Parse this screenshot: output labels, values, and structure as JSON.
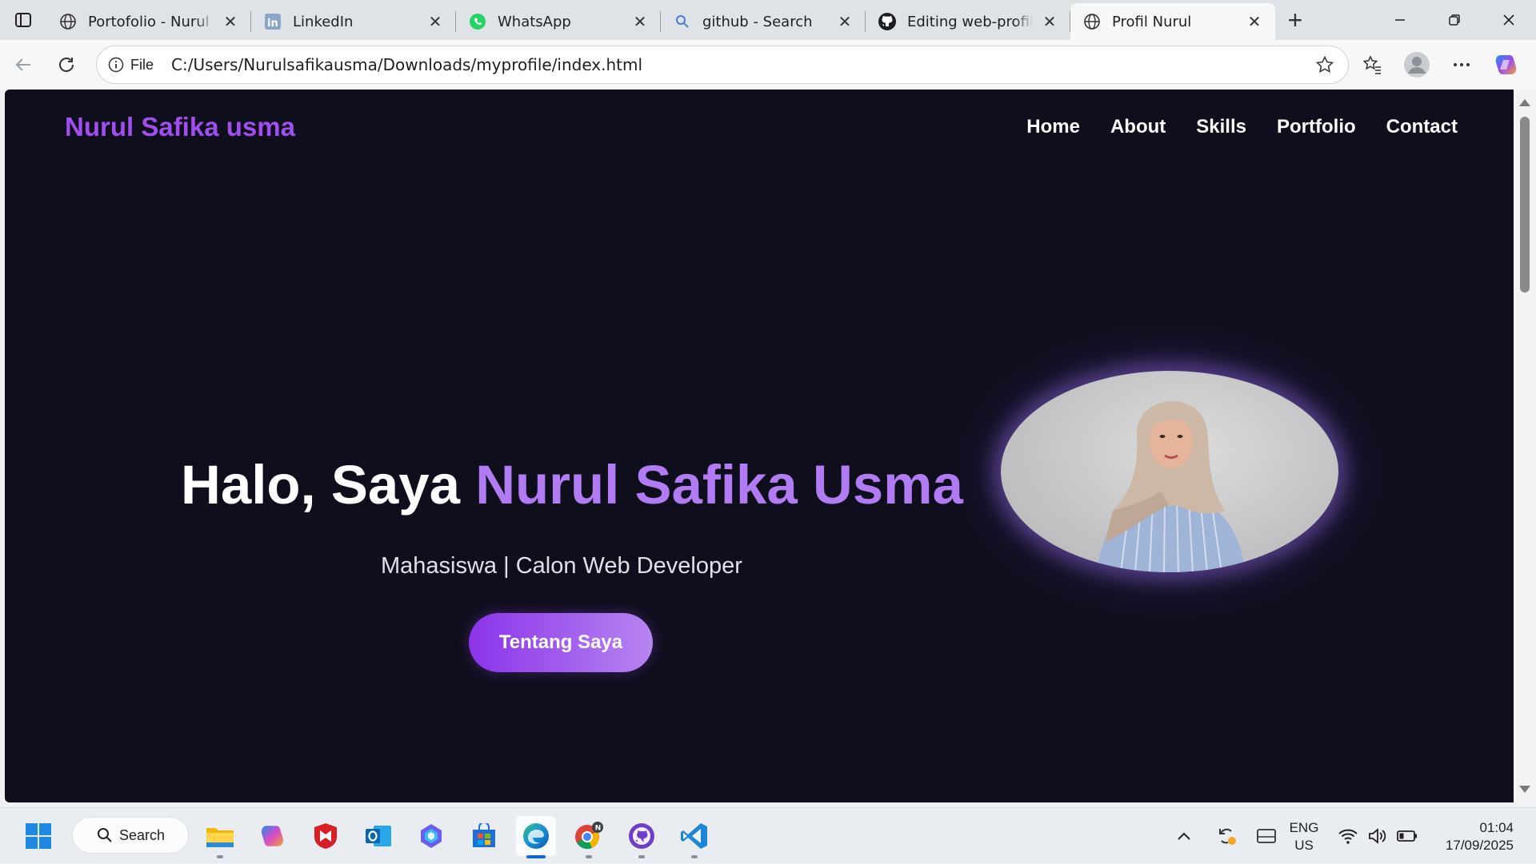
{
  "browser": {
    "tabs": [
      {
        "label": "Portofolio - Nurul Safika",
        "icon": "globe-icon",
        "active": false
      },
      {
        "label": "LinkedIn",
        "icon": "linkedin-icon",
        "active": false
      },
      {
        "label": "WhatsApp",
        "icon": "whatsapp-icon",
        "active": false
      },
      {
        "label": "github - Search",
        "icon": "search-icon",
        "active": false
      },
      {
        "label": "Editing web-profile-nurul",
        "icon": "github-icon",
        "active": false
      },
      {
        "label": "Profil Nurul",
        "icon": "globe-icon",
        "active": true
      }
    ],
    "address": {
      "scheme_label": "File",
      "url": "C:/Users/Nurulsafikausma/Downloads/myprofile/index.html"
    }
  },
  "site": {
    "brand": "Nurul Safika usma",
    "nav": [
      "Home",
      "About",
      "Skills",
      "Portfolio",
      "Contact"
    ],
    "hero": {
      "greeting": "Halo, Saya ",
      "name": "Nurul Safika Usma",
      "subtitle": "Mahasiswa | Calon Web Developer",
      "button": "Tentang Saya"
    },
    "colors": {
      "background": "#0f0e1c",
      "brand": "#a04fee",
      "highlight": "#b17bf4",
      "button_start": "#8b33ea",
      "button_end": "#b785f1"
    }
  },
  "taskbar": {
    "search_label": "Search",
    "apps": [
      "start-icon",
      "file-explorer-icon",
      "copilot-icon",
      "mcafee-icon",
      "outlook-icon",
      "m365-icon",
      "store-icon",
      "edge-icon",
      "chrome-icon",
      "github-desktop-icon",
      "vscode-icon"
    ],
    "language": {
      "line1": "ENG",
      "line2": "US"
    },
    "time": "01:04",
    "date": "17/09/2025"
  }
}
